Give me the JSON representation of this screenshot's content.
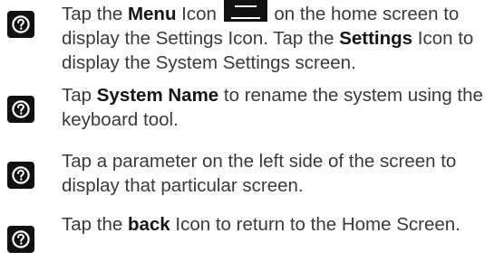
{
  "steps": [
    {
      "icon": "question-circle-icon",
      "parts": {
        "a": "Tap the ",
        "b": "Menu",
        "c": " Icon ",
        "d": " on the home screen to display the Settings Icon. Tap the ",
        "e": "Settings",
        "f": " Icon to display the System Settings screen."
      },
      "inline_icon": "menu-icon"
    },
    {
      "icon": "question-circle-icon",
      "parts": {
        "a": "Tap ",
        "b": "System Name",
        "c": " to rename the system using the keyboard tool."
      }
    },
    {
      "icon": "question-circle-icon",
      "parts": {
        "a": "Tap a parameter on the left side of the screen to display that particular screen."
      }
    },
    {
      "icon": "question-circle-icon",
      "parts": {
        "a": "Tap the ",
        "b": "back",
        "c": " Icon to return to the Home Screen."
      }
    }
  ],
  "colors": {
    "badge_bg": "#111111",
    "text": "#3a3a3a",
    "bold_text": "#151515"
  }
}
